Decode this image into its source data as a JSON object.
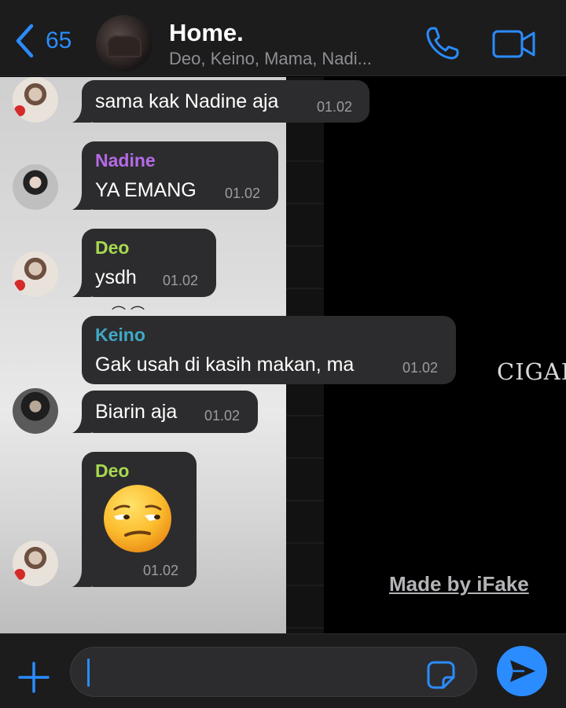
{
  "header": {
    "back_count": "65",
    "title": "Home.",
    "subtitle": "Deo, Keino, Mama, Nadi..."
  },
  "wallpaper": {
    "text": "CIGAR",
    "watermark": "Made by iFake"
  },
  "messages": [
    {
      "sender": "",
      "text": "sama kak Nadine aja",
      "time": "01.02"
    },
    {
      "sender": "Nadine",
      "sender_color": "#b66ae8",
      "text": "YA EMANG",
      "time": "01.02"
    },
    {
      "sender": "Deo",
      "sender_color": "#a7d94f",
      "text": "ysdh",
      "time": "01.02"
    },
    {
      "sender": "Keino",
      "sender_color": "#3fa9c6",
      "text": "Gak usah di kasih makan, ma",
      "time": "01.02"
    },
    {
      "sender": "",
      "text": "Biarin aja",
      "time": "01.02"
    },
    {
      "sender": "Deo",
      "sender_color": "#a7d94f",
      "emoji": "unamused-face",
      "time": "01.02"
    }
  ],
  "icons": {
    "back": "chevron-left-icon",
    "call": "phone-icon",
    "video": "video-camera-icon",
    "add": "plus-icon",
    "sticker": "sticker-icon",
    "send": "send-icon"
  },
  "colors": {
    "accent": "#2a8cff",
    "bubble": "#2c2c2e",
    "bar": "#1c1c1d"
  }
}
